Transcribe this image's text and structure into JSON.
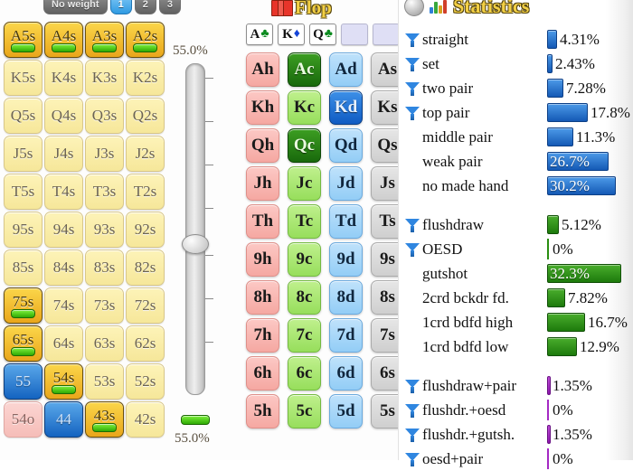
{
  "weight_toolbar": {
    "buttons": [
      {
        "label": "No weight",
        "selected": false
      },
      {
        "label": "1",
        "selected": true
      },
      {
        "label": "2",
        "selected": false
      },
      {
        "label": "3",
        "selected": false
      }
    ]
  },
  "hand_grid": {
    "rows": [
      [
        {
          "label": "A5s",
          "state": "gold",
          "bar": true
        },
        {
          "label": "A4s",
          "state": "gold",
          "bar": true
        },
        {
          "label": "A3s",
          "state": "gold",
          "bar": true
        },
        {
          "label": "A2s",
          "state": "gold",
          "bar": true
        }
      ],
      [
        {
          "label": "K5s",
          "state": "plain",
          "bar": false
        },
        {
          "label": "K4s",
          "state": "plain",
          "bar": false
        },
        {
          "label": "K3s",
          "state": "plain",
          "bar": false
        },
        {
          "label": "K2s",
          "state": "plain",
          "bar": false
        }
      ],
      [
        {
          "label": "Q5s",
          "state": "plain",
          "bar": false
        },
        {
          "label": "Q4s",
          "state": "plain",
          "bar": false
        },
        {
          "label": "Q3s",
          "state": "plain",
          "bar": false
        },
        {
          "label": "Q2s",
          "state": "plain",
          "bar": false
        }
      ],
      [
        {
          "label": "J5s",
          "state": "plain",
          "bar": false
        },
        {
          "label": "J4s",
          "state": "plain",
          "bar": false
        },
        {
          "label": "J3s",
          "state": "plain",
          "bar": false
        },
        {
          "label": "J2s",
          "state": "plain",
          "bar": false
        }
      ],
      [
        {
          "label": "T5s",
          "state": "plain",
          "bar": false
        },
        {
          "label": "T4s",
          "state": "plain",
          "bar": false
        },
        {
          "label": "T3s",
          "state": "plain",
          "bar": false
        },
        {
          "label": "T2s",
          "state": "plain",
          "bar": false
        }
      ],
      [
        {
          "label": "95s",
          "state": "plain",
          "bar": false
        },
        {
          "label": "94s",
          "state": "plain",
          "bar": false
        },
        {
          "label": "93s",
          "state": "plain",
          "bar": false
        },
        {
          "label": "92s",
          "state": "plain",
          "bar": false
        }
      ],
      [
        {
          "label": "85s",
          "state": "plain",
          "bar": false
        },
        {
          "label": "84s",
          "state": "plain",
          "bar": false
        },
        {
          "label": "83s",
          "state": "plain",
          "bar": false
        },
        {
          "label": "82s",
          "state": "plain",
          "bar": false
        }
      ],
      [
        {
          "label": "75s",
          "state": "gold",
          "bar": true
        },
        {
          "label": "74s",
          "state": "plain",
          "bar": false
        },
        {
          "label": "73s",
          "state": "plain",
          "bar": false
        },
        {
          "label": "72s",
          "state": "plain",
          "bar": false
        }
      ],
      [
        {
          "label": "65s",
          "state": "gold",
          "bar": true
        },
        {
          "label": "64s",
          "state": "plain",
          "bar": false
        },
        {
          "label": "63s",
          "state": "plain",
          "bar": false
        },
        {
          "label": "62s",
          "state": "plain",
          "bar": false
        }
      ],
      [
        {
          "label": "55",
          "state": "blue",
          "bar": false
        },
        {
          "label": "54s",
          "state": "gold",
          "bar": true
        },
        {
          "label": "53s",
          "state": "plain",
          "bar": false
        },
        {
          "label": "52s",
          "state": "plain",
          "bar": false
        }
      ],
      [
        {
          "label": "54o",
          "state": "pink",
          "bar": false
        },
        {
          "label": "44",
          "state": "blue",
          "bar": false
        },
        {
          "label": "43s",
          "state": "gold",
          "bar": true
        },
        {
          "label": "42s",
          "state": "plain",
          "bar": false
        }
      ]
    ]
  },
  "slider": {
    "top_value": "55.0%",
    "bottom_value": "55.0%"
  },
  "flop": {
    "title": "Flop",
    "board": [
      {
        "rank": "A",
        "suit": "♣",
        "suit_class": "s-c",
        "empty": false
      },
      {
        "rank": "K",
        "suit": "♦",
        "suit_class": "s-d",
        "empty": false
      },
      {
        "rank": "Q",
        "suit": "♣",
        "suit_class": "s-c",
        "empty": false
      },
      {
        "rank": "",
        "suit": "",
        "suit_class": "",
        "empty": true
      },
      {
        "rank": "",
        "suit": "",
        "suit_class": "",
        "empty": true
      }
    ],
    "card_rows": [
      [
        {
          "label": "Ah",
          "suit": "h",
          "selected": false
        },
        {
          "label": "Ac",
          "suit": "c",
          "selected": true
        },
        {
          "label": "Ad",
          "suit": "d",
          "selected": false
        },
        {
          "label": "As",
          "suit": "s",
          "selected": false
        }
      ],
      [
        {
          "label": "Kh",
          "suit": "h",
          "selected": false
        },
        {
          "label": "Kc",
          "suit": "c",
          "selected": false
        },
        {
          "label": "Kd",
          "suit": "d",
          "selected": true
        },
        {
          "label": "Ks",
          "suit": "s",
          "selected": false
        }
      ],
      [
        {
          "label": "Qh",
          "suit": "h",
          "selected": false
        },
        {
          "label": "Qc",
          "suit": "c",
          "selected": true
        },
        {
          "label": "Qd",
          "suit": "d",
          "selected": false
        },
        {
          "label": "Qs",
          "suit": "s",
          "selected": false
        }
      ],
      [
        {
          "label": "Jh",
          "suit": "h",
          "selected": false
        },
        {
          "label": "Jc",
          "suit": "c",
          "selected": false
        },
        {
          "label": "Jd",
          "suit": "d",
          "selected": false
        },
        {
          "label": "Js",
          "suit": "s",
          "selected": false
        }
      ],
      [
        {
          "label": "Th",
          "suit": "h",
          "selected": false
        },
        {
          "label": "Tc",
          "suit": "c",
          "selected": false
        },
        {
          "label": "Td",
          "suit": "d",
          "selected": false
        },
        {
          "label": "Ts",
          "suit": "s",
          "selected": false
        }
      ],
      [
        {
          "label": "9h",
          "suit": "h",
          "selected": false
        },
        {
          "label": "9c",
          "suit": "c",
          "selected": false
        },
        {
          "label": "9d",
          "suit": "d",
          "selected": false
        },
        {
          "label": "9s",
          "suit": "s",
          "selected": false
        }
      ],
      [
        {
          "label": "8h",
          "suit": "h",
          "selected": false
        },
        {
          "label": "8c",
          "suit": "c",
          "selected": false
        },
        {
          "label": "8d",
          "suit": "d",
          "selected": false
        },
        {
          "label": "8s",
          "suit": "s",
          "selected": false
        }
      ],
      [
        {
          "label": "7h",
          "suit": "h",
          "selected": false
        },
        {
          "label": "7c",
          "suit": "c",
          "selected": false
        },
        {
          "label": "7d",
          "suit": "d",
          "selected": false
        },
        {
          "label": "7s",
          "suit": "s",
          "selected": false
        }
      ],
      [
        {
          "label": "6h",
          "suit": "h",
          "selected": false
        },
        {
          "label": "6c",
          "suit": "c",
          "selected": false
        },
        {
          "label": "6d",
          "suit": "d",
          "selected": false
        },
        {
          "label": "6s",
          "suit": "s",
          "selected": false
        }
      ],
      [
        {
          "label": "5h",
          "suit": "h",
          "selected": false
        },
        {
          "label": "5c",
          "suit": "c",
          "selected": false
        },
        {
          "label": "5d",
          "suit": "d",
          "selected": false
        },
        {
          "label": "5s",
          "suit": "s",
          "selected": false
        }
      ]
    ]
  },
  "statistics": {
    "title": "Statistics",
    "colors": {
      "made_hand": "#1459b5",
      "draw": "#1d7a0c",
      "combo": "#8d17ad"
    },
    "groups": [
      {
        "color": "blue",
        "rows": [
          {
            "label": "straight",
            "value": "4.31%",
            "pct": 4.31,
            "filter": true,
            "inside": false
          },
          {
            "label": "set",
            "value": "2.43%",
            "pct": 2.43,
            "filter": true,
            "inside": false
          },
          {
            "label": "two pair",
            "value": "7.28%",
            "pct": 7.28,
            "filter": true,
            "inside": false
          },
          {
            "label": "top pair",
            "value": "17.8%",
            "pct": 17.8,
            "filter": true,
            "inside": false
          },
          {
            "label": "middle pair",
            "value": "11.3%",
            "pct": 11.3,
            "filter": false,
            "inside": false
          },
          {
            "label": "weak pair",
            "value": "26.7%",
            "pct": 26.7,
            "filter": false,
            "inside": true
          },
          {
            "label": "no made hand",
            "value": "30.2%",
            "pct": 30.2,
            "filter": false,
            "inside": true
          }
        ]
      },
      {
        "color": "green",
        "rows": [
          {
            "label": "flushdraw",
            "value": "5.12%",
            "pct": 5.12,
            "filter": true,
            "inside": false
          },
          {
            "label": "OESD",
            "value": "0%",
            "pct": 0,
            "filter": true,
            "inside": false
          },
          {
            "label": "gutshot",
            "value": "32.3%",
            "pct": 32.3,
            "filter": false,
            "inside": true
          },
          {
            "label": "2crd bckdr fd.",
            "value": "7.82%",
            "pct": 7.82,
            "filter": false,
            "inside": false
          },
          {
            "label": "1crd bdfd high",
            "value": "16.7%",
            "pct": 16.7,
            "filter": false,
            "inside": false
          },
          {
            "label": "1crd bdfd low",
            "value": "12.9%",
            "pct": 12.9,
            "filter": false,
            "inside": false
          }
        ]
      },
      {
        "color": "purple",
        "rows": [
          {
            "label": "flushdraw+pair",
            "value": "1.35%",
            "pct": 1.35,
            "filter": true,
            "inside": false
          },
          {
            "label": "flushdr.+oesd",
            "value": "0%",
            "pct": 0,
            "filter": true,
            "inside": false
          },
          {
            "label": "flushdr.+gutsh.",
            "value": "1.35%",
            "pct": 1.35,
            "filter": true,
            "inside": false
          },
          {
            "label": "oesd+pair",
            "value": "0%",
            "pct": 0,
            "filter": true,
            "inside": false
          }
        ]
      }
    ]
  }
}
